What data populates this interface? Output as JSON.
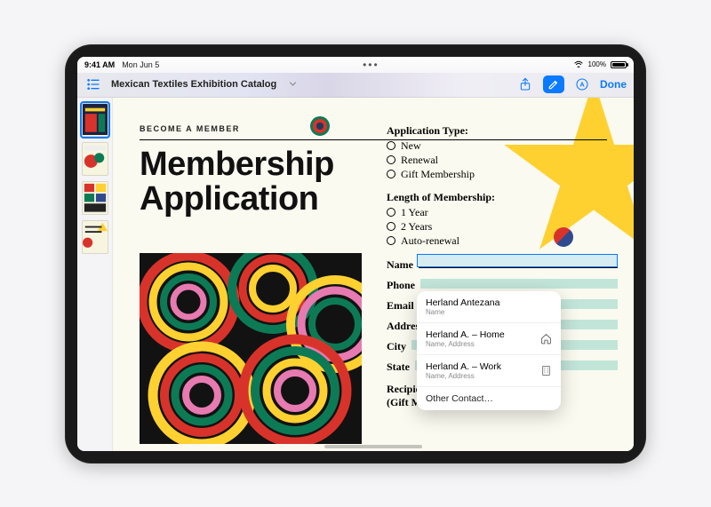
{
  "statusbar": {
    "time": "9:41 AM",
    "date": "Mon Jun 5",
    "battery": "100%"
  },
  "toolbar": {
    "title": "Mexican Textiles Exhibition Catalog",
    "done": "Done"
  },
  "doc": {
    "become": "BECOME A MEMBER",
    "headline1": "Membership",
    "headline2": "Application"
  },
  "form": {
    "app_type_label": "Application Type:",
    "app_types": [
      "New",
      "Renewal",
      "Gift Membership"
    ],
    "length_label": "Length of Membership:",
    "lengths": [
      "1 Year",
      "2 Years",
      "Auto-renewal"
    ],
    "name": "Name",
    "phone": "Phone",
    "email": "Email",
    "address": "Address",
    "city": "City",
    "state": "State",
    "recipient_line1": "Recipient's Name",
    "recipient_line2": "(Gift Membership)"
  },
  "autofill": {
    "items": [
      {
        "name": "Herland Antezana",
        "sub": "Name",
        "icon": ""
      },
      {
        "name": "Herland A. – Home",
        "sub": "Name, Address",
        "icon": "home"
      },
      {
        "name": "Herland A. – Work",
        "sub": "Name, Address",
        "icon": "work"
      }
    ],
    "other": "Other Contact…"
  }
}
